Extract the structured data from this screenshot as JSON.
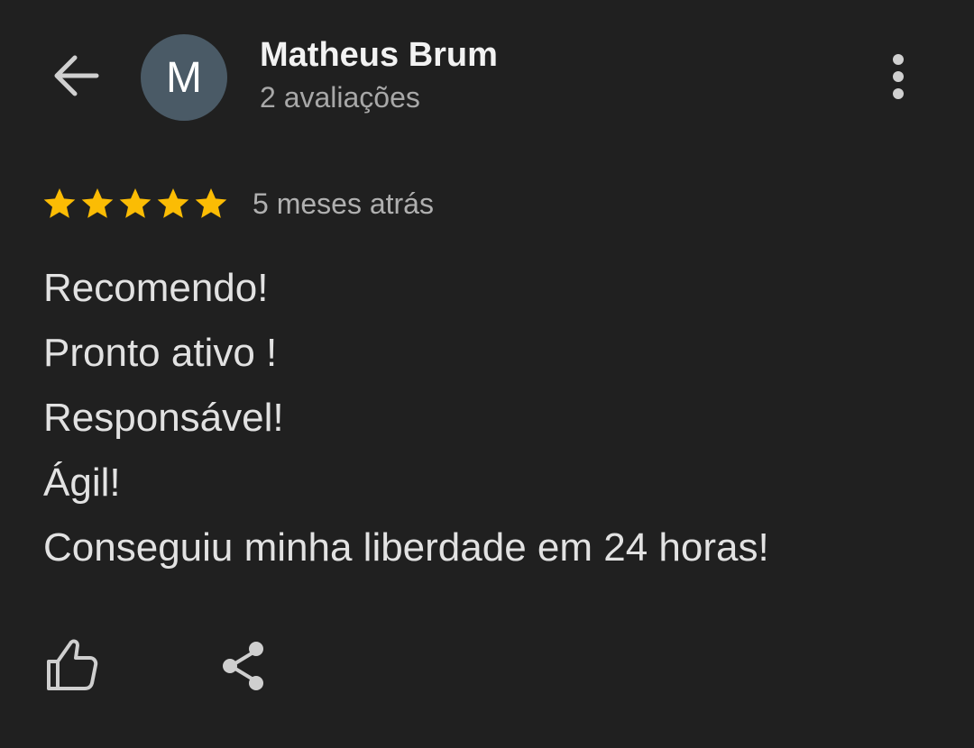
{
  "header": {
    "avatar_letter": "M",
    "avatar_color": "#4a5a66",
    "user_name": "Matheus Brum",
    "review_count": "2 avaliações",
    "back_icon": "arrow-left-icon",
    "more_icon": "more-vertical-icon"
  },
  "review": {
    "rating": 5,
    "max_rating": 5,
    "star_color": "#fbbc04",
    "date": "5 meses atrás",
    "lines": [
      "Recomendo!",
      "Pronto ativo !",
      "Responsável!",
      "Ágil!",
      "Conseguiu minha liberdade em 24 horas!"
    ]
  },
  "actions": {
    "like_icon": "thumbs-up-icon",
    "share_icon": "share-icon"
  }
}
